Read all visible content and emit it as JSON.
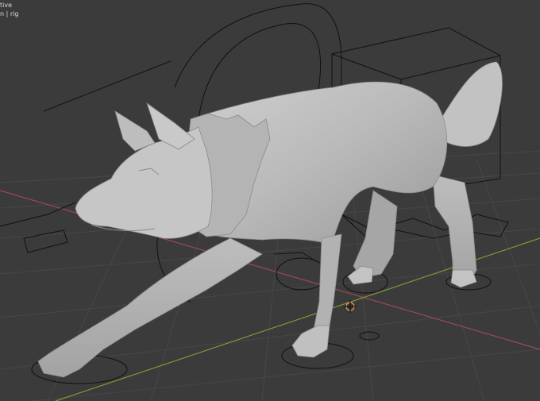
{
  "viewport": {
    "mode_text": "tive",
    "object_text": "n | rig"
  },
  "scene": {
    "background": "#3b3b3b",
    "grid_color": "#474747",
    "x_axis_color": "#9a4a55",
    "y_axis_color": "#7a9a3a",
    "mesh_color": "#b8b8b8",
    "mesh_shadow": "#8c8c8c",
    "rig_line_color": "#111111",
    "cursor_color": "#e8a04a"
  }
}
